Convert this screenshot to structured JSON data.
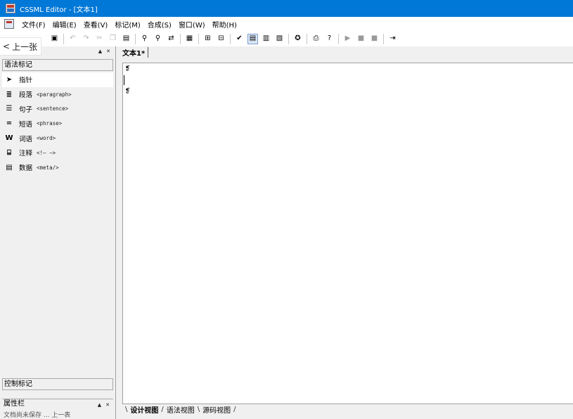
{
  "window": {
    "title": "CSSML Editor - [文本1]"
  },
  "menu": {
    "items": [
      {
        "label": "文件(F)"
      },
      {
        "label": "编辑(E)"
      },
      {
        "label": "查看(V)"
      },
      {
        "label": "标记(M)"
      },
      {
        "label": "合成(S)"
      },
      {
        "label": "窗口(W)"
      },
      {
        "label": "帮助(H)"
      }
    ]
  },
  "overlay": {
    "back_label": "上一张"
  },
  "left_panel": {
    "syntax_section": "语法标记",
    "items": [
      {
        "label": "指针",
        "tag": ""
      },
      {
        "label": "段落",
        "tag": "<paragraph>"
      },
      {
        "label": "句子",
        "tag": "<sentence>"
      },
      {
        "label": "短语",
        "tag": "<phrase>"
      },
      {
        "label": "词语",
        "tag": "<word>"
      },
      {
        "label": "注释",
        "tag": "<!— —>"
      },
      {
        "label": "数据",
        "tag": "<meta/>"
      }
    ],
    "control_section": "控制标记",
    "properties_title": "属性栏",
    "properties_row": "文档尚未保存 ... 上一表"
  },
  "document": {
    "tab_label": "文本1*"
  },
  "view_tabs": [
    {
      "label": "设计视图"
    },
    {
      "label": "语法视图"
    },
    {
      "label": "源码视图"
    }
  ],
  "colors": {
    "titlebar": "#0078d7",
    "editor_bg": "#ffffff",
    "chrome_bg": "#f0f0f0"
  }
}
